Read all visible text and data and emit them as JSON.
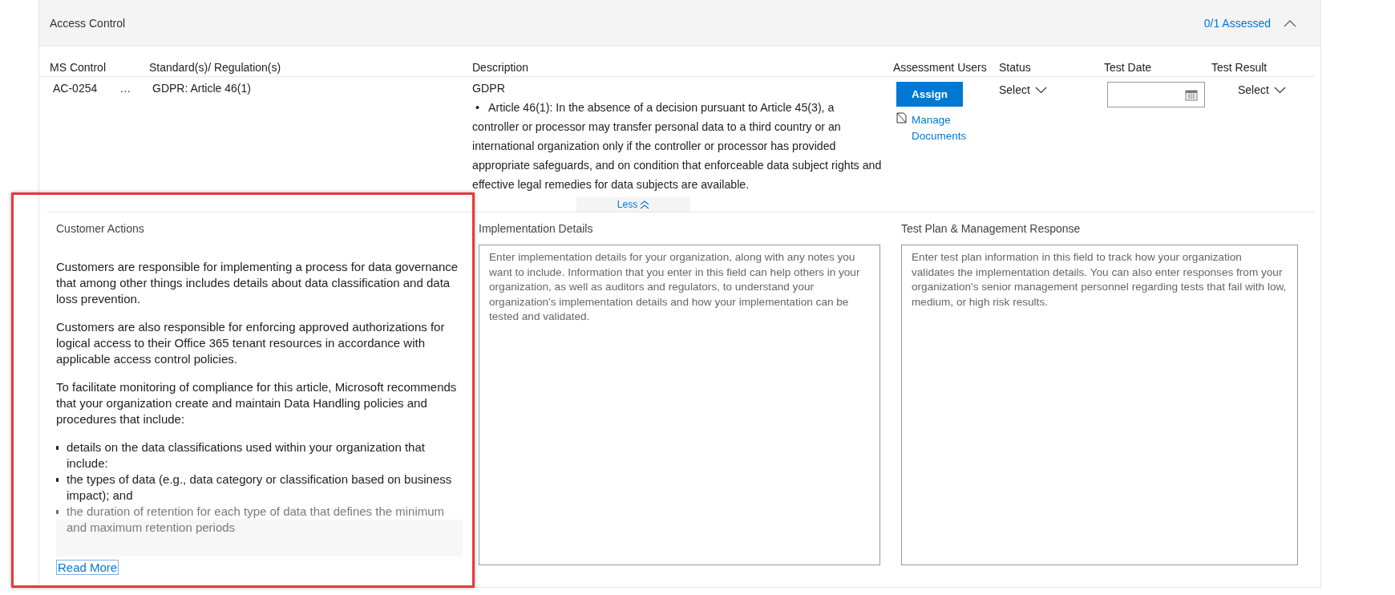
{
  "section": {
    "title": "Access Control",
    "assessed": "0/1 Assessed",
    "expanded": true
  },
  "columns": [
    "MS Control",
    "Standard(s)/ Regulation(s)",
    "Description",
    "Assessment Users",
    "Status",
    "Test Date",
    "Test Result"
  ],
  "row": {
    "control_id": "AC-0254",
    "more": "…",
    "standard": "GDPR: Article 46(1)",
    "description_title": "GDPR",
    "description_bullets": [
      "•   Article 46(1): In the absence of a decision pursuant to Article 45(3), a controller or processor may transfer personal data to a third country or an international organization only if the controller or processor has provided appropriate safeguards, and on condition that enforceable data subject rights and effective legal remedies for data subjects are available."
    ],
    "assign": "Assign",
    "manage_documents": "Manage Documents",
    "status": "Select",
    "test_result": "Select"
  },
  "less": "Less",
  "customer_actions": {
    "title": "Customer Actions",
    "paragraphs": [
      "Customers are responsible for implementing a process for data governance that among other things includes details about data classification and data loss prevention.",
      "Customers are also responsible for enforcing approved authorizations for logical access to their Office 365 tenant resources in accordance with applicable access control policies.",
      "To facilitate monitoring of compliance for this article, Microsoft recommends that your organization create and maintain Data Handling policies and procedures that include:"
    ],
    "bullets": [
      "details on the data classifications used within your organization that include:",
      "the types of data (e.g., data category or classification based on business impact); and",
      "the duration of retention for each type of data that defines the minimum and maximum retention periods"
    ],
    "read_more": "Read More"
  },
  "implementation": {
    "title": "Implementation Details",
    "placeholder": "Enter implementation details for your organization, along with any notes you want to include. Information that you enter in this field can help others in your organization, as well as auditors and regulators, to understand your organization's implementation details and how your implementation can be tested and validated."
  },
  "test_plan": {
    "title": "Test Plan & Management Response",
    "placeholder": "Enter test plan information in this field to track how your organization validates the implementation details. You can also enter responses from your organization's senior management personnel regarding tests that fail with low, medium, or high risk results."
  }
}
